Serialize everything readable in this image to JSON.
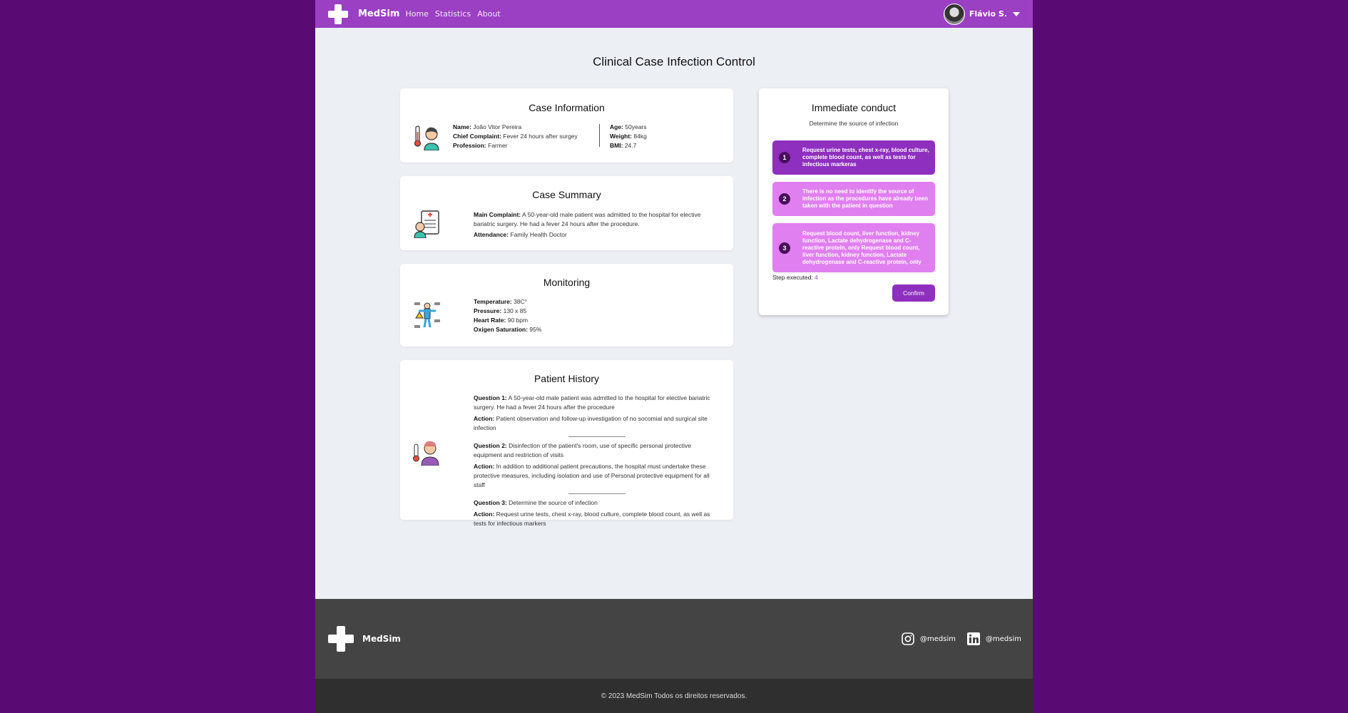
{
  "nav": {
    "brand": "MedSim",
    "links": [
      "Home",
      "Statistics",
      "About"
    ],
    "user": "Flávio S."
  },
  "page_title": "Clinical Case Infection Control",
  "case_info": {
    "title": "Case Information",
    "name_label": "Name:",
    "name": "João Vitor Pereira",
    "complaint_label": "Chief Complaint:",
    "complaint": "Fever 24 hours after surgey",
    "profession_label": "Profession:",
    "profession": "Farmer",
    "age_label": "Age:",
    "age": "50years",
    "weight_label": "Weight:",
    "weight": "84kg",
    "bmi_label": "BMI:",
    "bmi": "24.7"
  },
  "summary": {
    "title": "Case Summary",
    "main_label": "Main Complaint:",
    "main": "A 50-year-old male patient was admitted to the hospital for elective bariatric surgery. He had a fever 24 hours after the procedure.",
    "attendance_label": "Attendance:",
    "attendance": "Family Health Doctor"
  },
  "monitoring": {
    "title": "Monitoring",
    "temp_label": "Temperature:",
    "temp": "38C°",
    "pressure_label": "Pressure:",
    "pressure": "130 x 85",
    "hr_label": "Heart Rate:",
    "hr": "90 bpm",
    "o2_label": "Oxigen Saturation:",
    "o2": "95%"
  },
  "history": {
    "title": "Patient History",
    "items": [
      {
        "q_label": "Question 1:",
        "q": "A 50-year-old male patient was admitted to the hospital for elective bariatric surgery. He had a fever 24 hours after the procedure",
        "a_label": "Action:",
        "a": "Patient observation and follow-up investigation of no socomial and surgical site infection"
      },
      {
        "q_label": "Question 2:",
        "q": "Disinfection of the patient's room, use of specific personal protective equipment and restriction of visits",
        "a_label": "Action:",
        "a": "In addition to additional patient precautions, the hospital must undertake these protective measures, including isolation and use of Personal protective equipment for all staff"
      },
      {
        "q_label": "Question 3:",
        "q": "Determine the source of infection",
        "a_label": "Action:",
        "a": "Request urine tests, chest x-ray, blood culture, complete blood count, as well as tests for infectious markers"
      }
    ]
  },
  "conduct": {
    "title": "Immediate conduct",
    "subtitle": "Determine the source of infection",
    "options": [
      {
        "num": "1",
        "text": "Request urine tests, chest x-ray, blood culture, complete blood count, as well as tests for infectious markeras"
      },
      {
        "num": "2",
        "text": "There is no need to identify the source of infection as the procedures have already been taken with the patient in question"
      },
      {
        "num": "3",
        "text": "Request blood count, liver function, kidney function, Lactate dehydrogenase and C-reactive protein, only Request blood count, liver function, kidney function, Lactate dehydrogenase and C-reactive protein, only"
      }
    ],
    "step_label": "Step executed:",
    "step_value": "4",
    "confirm": "Confirm"
  },
  "footer": {
    "brand": "MedSim",
    "instagram": "@medsim",
    "linkedin": "@medsim",
    "copyright": "© 2023 MedSim Todos os direitos reservados."
  },
  "colors": {
    "primary": "#9b3fc3",
    "option_selected": "#8e2fbf",
    "option": "#e07ff0",
    "page_bg": "#5a0b73"
  }
}
